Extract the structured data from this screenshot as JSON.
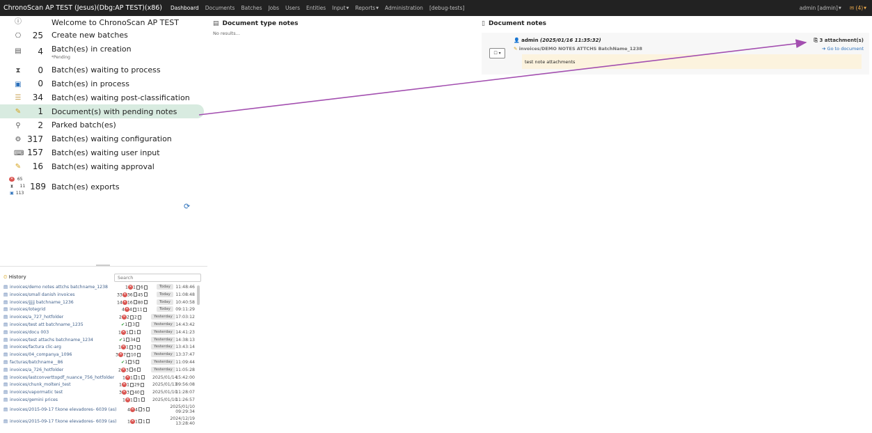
{
  "navbar": {
    "brand": "ChronoScan AP TEST (Jesus)(Dbg:AP TEST)(x86)",
    "items": [
      {
        "label": "Dashboard",
        "active": true
      },
      {
        "label": "Documents"
      },
      {
        "label": "Batches"
      },
      {
        "label": "Jobs"
      },
      {
        "label": "Users"
      },
      {
        "label": "Entities"
      },
      {
        "label": "Input",
        "dropdown": true
      },
      {
        "label": "Reports",
        "dropdown": true
      },
      {
        "label": "Administration"
      },
      {
        "label": "[debug-tests]"
      }
    ],
    "user": "admin [admin]",
    "mail_count": "(4)"
  },
  "dashboard": {
    "welcome": "Welcome to ChronoScan AP TEST",
    "rows": [
      {
        "icon": "create-batch-icon",
        "count": "25",
        "label": "Create new batches"
      },
      {
        "icon": "batch-creation-icon",
        "count": "4",
        "label": "Batch(es) in creation",
        "sub": "*Pending"
      },
      {
        "icon": "hourglass-icon",
        "count": "0",
        "label": "Batch(es) waiting to process"
      },
      {
        "icon": "process-icon",
        "count": "0",
        "label": "Batch(es) in process"
      },
      {
        "icon": "classification-icon",
        "count": "34",
        "label": "Batch(es) waiting post-classification"
      },
      {
        "icon": "pending-notes-icon",
        "count": "1",
        "label": "Document(s) with pending notes",
        "highlight": true
      },
      {
        "icon": "parked-icon",
        "count": "2",
        "label": "Parked batch(es)"
      },
      {
        "icon": "configuration-icon",
        "count": "317",
        "label": "Batch(es) waiting configuration"
      },
      {
        "icon": "user-input-icon",
        "count": "157",
        "label": "Batch(es) waiting user input"
      },
      {
        "icon": "approval-icon",
        "count": "16",
        "label": "Batch(es) waiting approval"
      }
    ],
    "exports": {
      "count": "189",
      "label": "Batch(es) exports",
      "mini": [
        {
          "icon": "error-icon",
          "count": "65"
        },
        {
          "icon": "hourglass-icon",
          "count": "11"
        },
        {
          "icon": "exported-icon",
          "count": "113"
        }
      ]
    }
  },
  "doc_type_notes": {
    "title": "Document type notes",
    "empty": "No results..."
  },
  "doc_notes": {
    "title": "Document notes",
    "note": {
      "author": "admin",
      "timestamp": "(2025/01/16 11:35:32)",
      "document": "invoices/DEMO NOTES ATTCHS BatchName_1238",
      "attachments": "3 attachment(s)",
      "goto": "Go to document",
      "body": "test note attachments"
    }
  },
  "history": {
    "title": "History",
    "search_placeholder": "Search",
    "rows": [
      {
        "name": "invoices/demo notes attchs batchname_1238",
        "counts": "1 ⊗ 1 ▯ 6 ▯",
        "day": "Today",
        "time": "11:48:46"
      },
      {
        "name": "invoices/small danish invoices",
        "counts": "33 ⊗ 36 ▯ 45 ▯",
        "day": "Today",
        "time": "11:08:48"
      },
      {
        "name": "invoices/jjjjj batchname_1236",
        "counts": "14 ⊗ 16 ▯ 80 ▯",
        "day": "Today",
        "time": "10:40:58"
      },
      {
        "name": "invoices/lotegrid",
        "counts": "4 ⊗ 4 ▯ 11 ▯",
        "day": "Today",
        "time": "09:11:29"
      },
      {
        "name": "invoices/a_727_hotfolder",
        "counts": "2 ⊗ 2 ▯ 2 ▯",
        "day": "Yesterday",
        "time": "17:03:12"
      },
      {
        "name": "invoices/test att batchname_1235",
        "counts": "✔ 1 ▯ 3 ▯",
        "day": "Yesterday",
        "time": "14:43:42"
      },
      {
        "name": "invoices/docu 003",
        "counts": "1 ⊗ 1 ▯ 1 ▯",
        "day": "Yesterday",
        "time": "14:41:23"
      },
      {
        "name": "invoices/test attachs batchname_1234",
        "counts": "✔ 1 ▯ 34 ▯",
        "day": "Yesterday",
        "time": "14:38:13"
      },
      {
        "name": "invoices/factura clic-arg",
        "counts": "1 ⊗ 1 ▯ 3 ▯",
        "day": "Yesterday",
        "time": "13:43:14"
      },
      {
        "name": "invoices/04_companya_1096",
        "counts": "3 ⊗ 7 ▯ 10 ▯",
        "day": "Yesterday",
        "time": "13:37:47"
      },
      {
        "name": "facturas/batchname__86",
        "counts": "✔ 1 ▯ 5 ▯",
        "day": "Yesterday",
        "time": "11:09:44"
      },
      {
        "name": "invoices/a_726_hotfolder",
        "counts": "2 ⊗ 3 ▯ 6 ▯",
        "day": "Yesterday",
        "time": "11:05:28"
      },
      {
        "name": "invoices/lastconverttopdf_nuance_756_hotfolder",
        "counts": "1 ⊗ 1 ▯ 1 ▯",
        "date": "2025/01/14",
        "time": "15:42:00"
      },
      {
        "name": "invoices/chunk_molteni_test",
        "counts": "1 ⊗ 1 ▯ 29 ▯",
        "date": "2025/01/13",
        "time": "09:56:08"
      },
      {
        "name": "invoices/vapormatic test",
        "counts": "3 ⊗ 3 ▯ 40 ▯",
        "date": "2025/01/10",
        "time": "11:28:07"
      },
      {
        "name": "invoices/gemini prices",
        "counts": "1 ⊗ 1 ▯ 1 ▯",
        "date": "2025/01/10",
        "time": "11:26:57"
      },
      {
        "name": "invoices/2015-09-17 f.kone elevadores- 6039 (as)",
        "counts": "4 ⊗ 4 ▯ 5 ▯",
        "date": "2025/01/10",
        "time": "09:29:34",
        "tall": true
      },
      {
        "name": "invoices/2015-09-17 f.kone elevadores- 6039 (as)",
        "counts": "1 ⊗ 1 ▯ 1 ▯",
        "date": "2024/12/19",
        "time": "13:28:40",
        "tall": true
      }
    ]
  }
}
